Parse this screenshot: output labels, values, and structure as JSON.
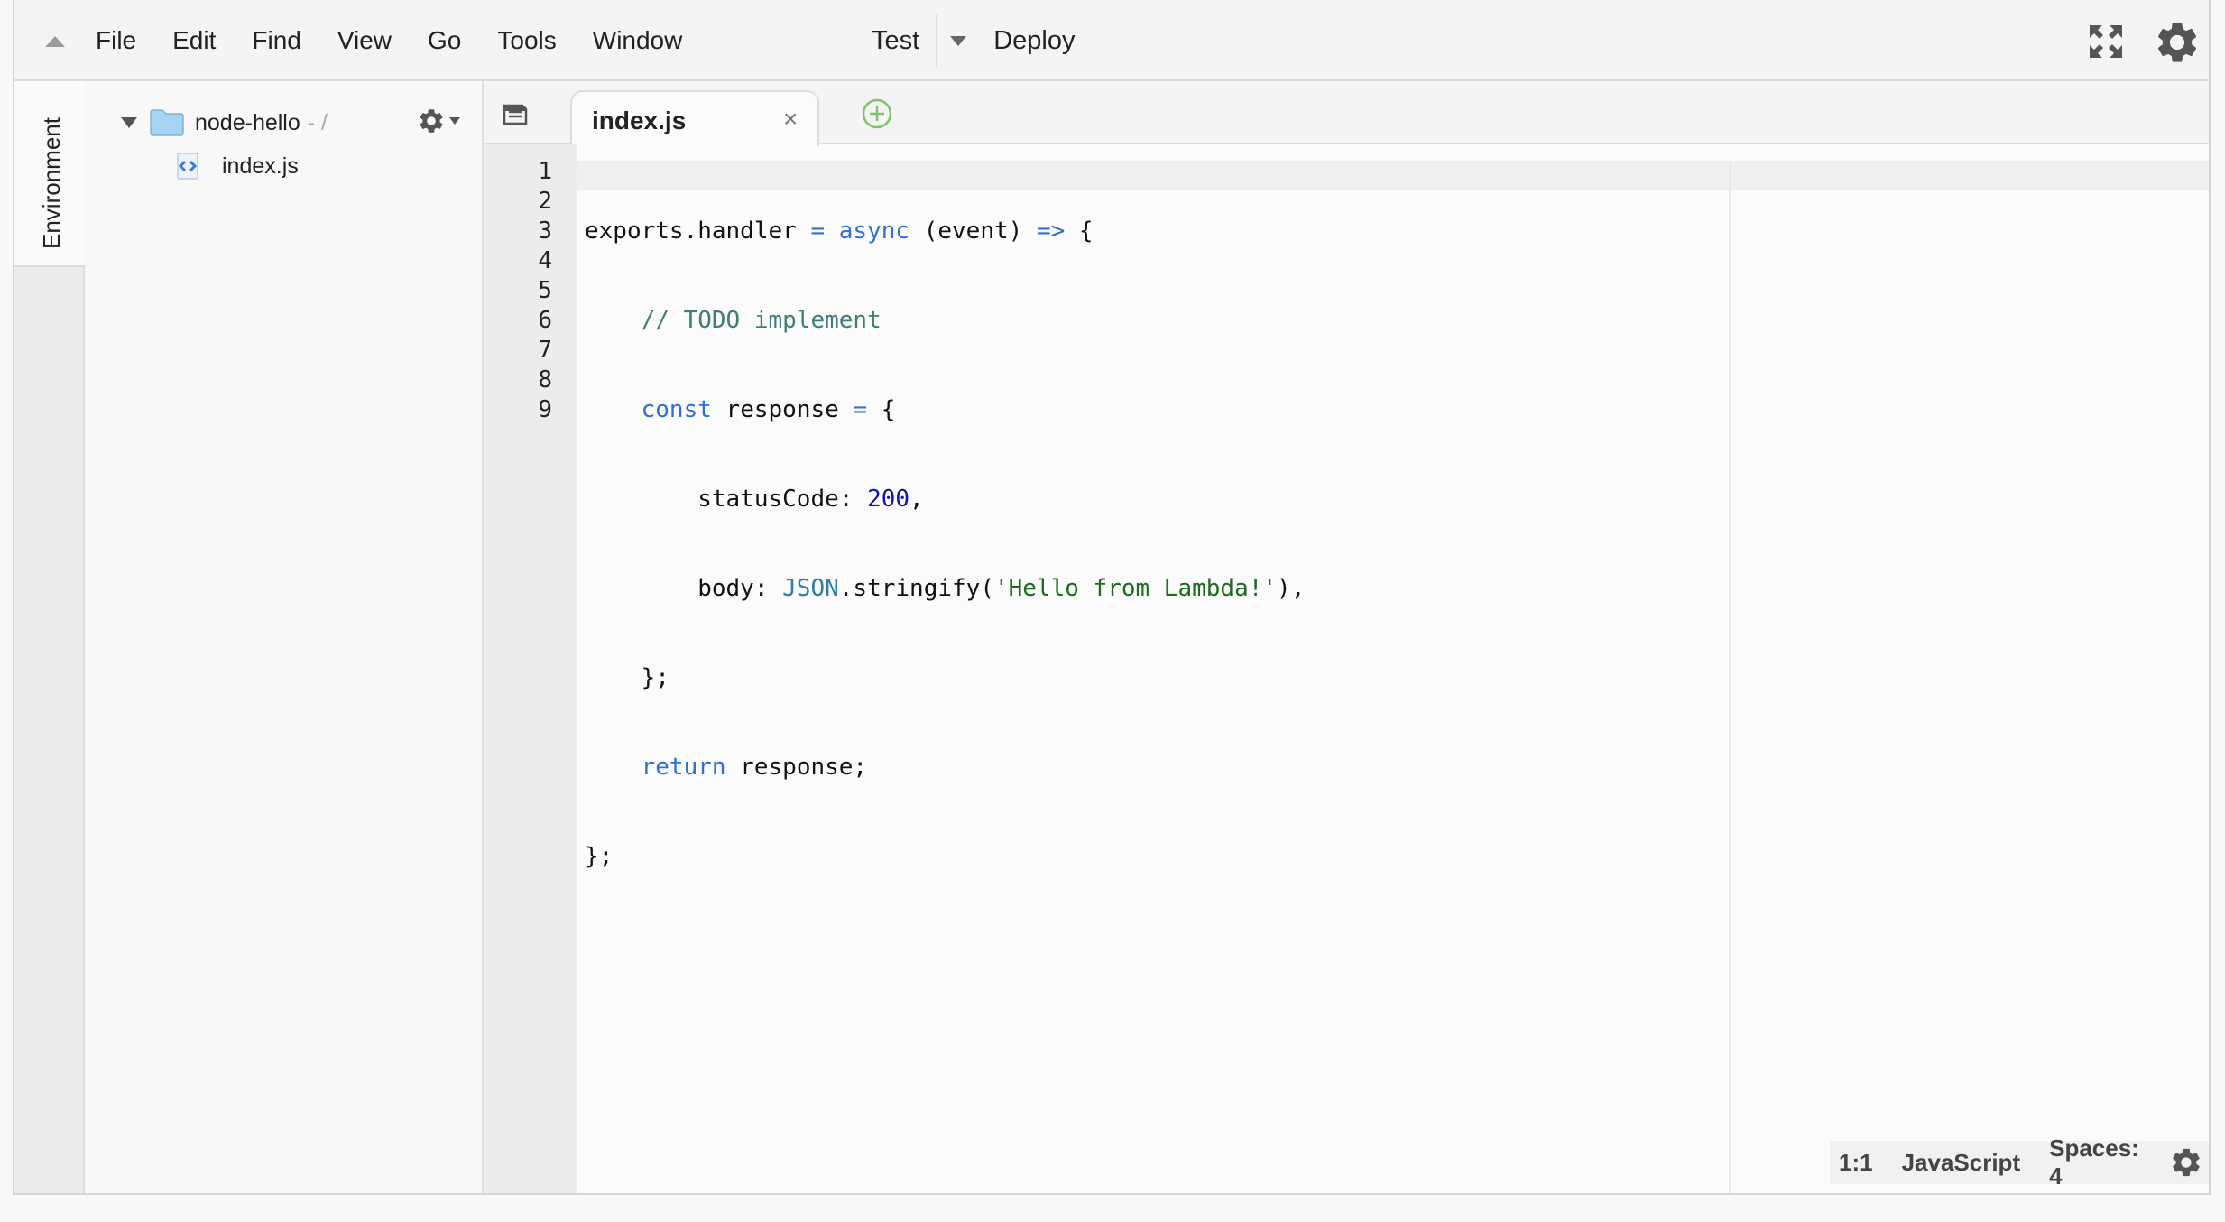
{
  "menubar": {
    "items": [
      "File",
      "Edit",
      "Find",
      "View",
      "Go",
      "Tools",
      "Window"
    ],
    "run": {
      "test_label": "Test",
      "deploy_label": "Deploy"
    }
  },
  "sidebar": {
    "environment_tab": "Environment"
  },
  "file_tree": {
    "root": {
      "name": "node-hello",
      "path_suffix": "- /"
    },
    "files": [
      "index.js"
    ]
  },
  "editor": {
    "tabs": [
      {
        "label": "index.js",
        "close": "×"
      }
    ],
    "line_numbers": [
      "1",
      "2",
      "3",
      "4",
      "5",
      "6",
      "7",
      "8",
      "9"
    ],
    "code_lines": [
      "exports.handler = async (event) => {",
      "    // TODO implement",
      "    const response = {",
      "        statusCode: 200,",
      "        body: JSON.stringify('Hello from Lambda!'),",
      "    };",
      "    return response;",
      "};",
      ""
    ]
  },
  "status_bar": {
    "cursor": "1:1",
    "language": "JavaScript",
    "indent": "Spaces: 4"
  },
  "colors": {
    "keyword": "#2f6fd6",
    "comment": "#3d7f77",
    "number": "#1414a8",
    "string": "#1d6b1d",
    "folder": "#a7d3f2",
    "add_tab": "#7cc36a"
  },
  "icons": [
    "collapse-up-icon",
    "fullscreen-icon",
    "gear-icon",
    "folder-icon",
    "js-file-icon",
    "tab-list-icon",
    "add-tab-icon"
  ]
}
